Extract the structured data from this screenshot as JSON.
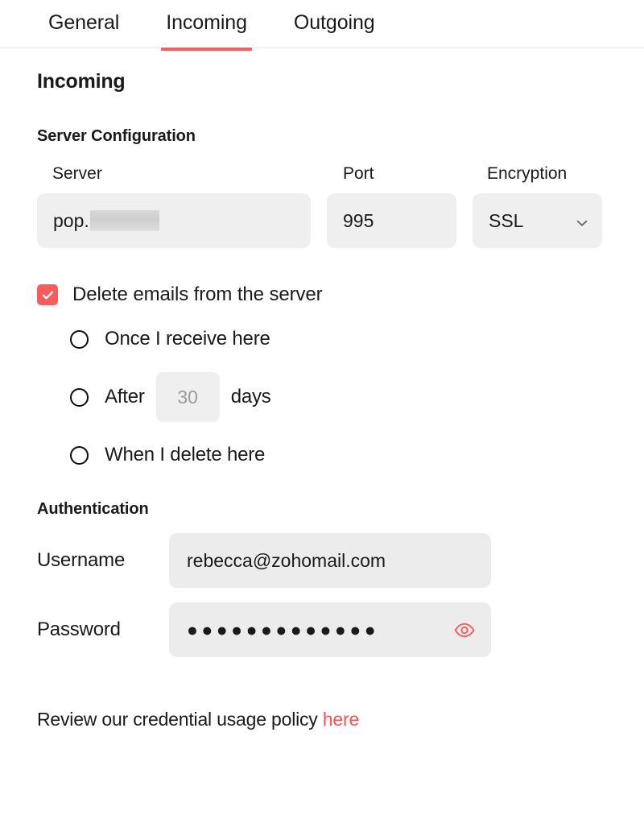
{
  "tabs": [
    {
      "label": "General",
      "active": false
    },
    {
      "label": "Incoming",
      "active": true
    },
    {
      "label": "Outgoing",
      "active": false
    }
  ],
  "page": {
    "title": "Incoming"
  },
  "server_section": {
    "heading": "Server Configuration",
    "server": {
      "label": "Server",
      "value_prefix": "pop.",
      "redacted": true
    },
    "port": {
      "label": "Port",
      "value": "995"
    },
    "encryption": {
      "label": "Encryption",
      "value": "SSL",
      "options": [
        "SSL"
      ],
      "chevron_icon": "chevron-down-icon"
    }
  },
  "delete_options": {
    "checkbox_label": "Delete emails from the server",
    "checkbox_checked": true,
    "radios": [
      {
        "label": "Once I receive here",
        "selected": false
      },
      {
        "label": "After",
        "selected": false,
        "input_placeholder": "30",
        "suffix": "days"
      },
      {
        "label": "When I delete here",
        "selected": false
      }
    ]
  },
  "authentication": {
    "heading": "Authentication",
    "username": {
      "label": "Username",
      "value": "rebecca@zohomail.com"
    },
    "password": {
      "label": "Password",
      "masked_value": "●●●●●●●●●●●●●",
      "toggle_icon": "eye-icon"
    }
  },
  "footer": {
    "text": "Review our credential usage policy",
    "link_label": "here"
  },
  "colors": {
    "accent": "#fa5c5c",
    "link": "#fa5252",
    "field_bg": "#efefef",
    "text": "#1a1a1a",
    "placeholder": "#9a9a9a"
  }
}
